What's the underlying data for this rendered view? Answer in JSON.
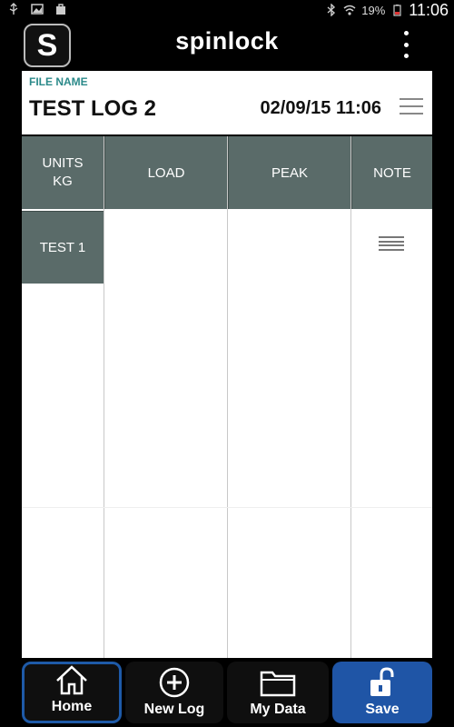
{
  "status_bar": {
    "battery": "19%",
    "time": "11:06",
    "icons": [
      "usb-icon",
      "image-icon",
      "bag-icon",
      "bluetooth-icon",
      "wifi-icon",
      "battery-icon"
    ]
  },
  "app_bar": {
    "logo": "S",
    "title": "spinlock"
  },
  "file": {
    "label": "FILE NAME",
    "name": "TEST LOG 2",
    "datetime": "02/09/15 11:06"
  },
  "table": {
    "units_line1": "UNITS",
    "units_line2": "KG",
    "columns": [
      "LOAD",
      "PEAK",
      "NOTE"
    ],
    "rows": [
      {
        "label": "TEST 1",
        "load": "",
        "peak": "",
        "note_icon": "list-icon"
      }
    ]
  },
  "bottom_nav": {
    "items": [
      {
        "label": "Home",
        "icon": "home-icon"
      },
      {
        "label": "New Log",
        "icon": "plus-circle-icon"
      },
      {
        "label": "My Data",
        "icon": "folder-icon"
      },
      {
        "label": "Save",
        "icon": "unlock-icon"
      }
    ]
  },
  "colors": {
    "header_bg": "#5a6b69",
    "accent_blue": "#1f55a6",
    "label_teal": "#2b8a8a"
  }
}
